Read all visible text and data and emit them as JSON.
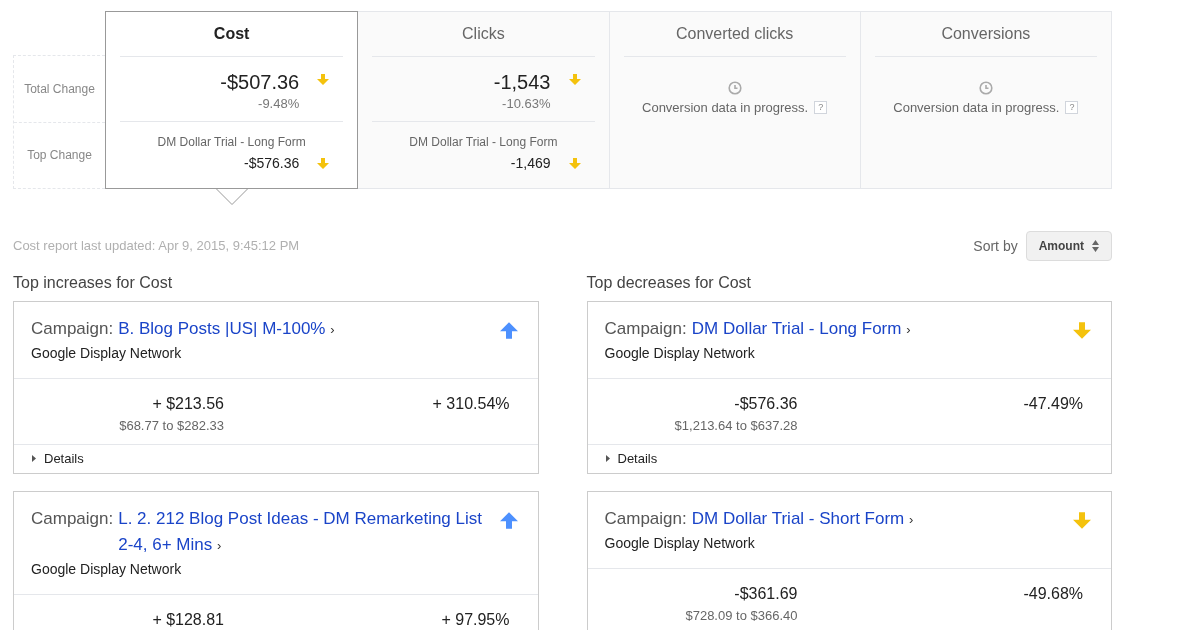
{
  "row_labels": [
    "Total Change",
    "Top Change"
  ],
  "metric_tabs": [
    {
      "title": "Cost",
      "selected": true,
      "kind": "data",
      "total": "-$507.36",
      "percent": "-9.48%",
      "increase": false,
      "top_name": "DM Dollar Trial - Long Form",
      "top_value": "-$576.36",
      "top_increase": false
    },
    {
      "title": "Clicks",
      "selected": false,
      "kind": "data",
      "total": "-1,543",
      "percent": "-10.63%",
      "increase": false,
      "top_name": "DM Dollar Trial - Long Form",
      "top_value": "-1,469",
      "top_increase": false
    },
    {
      "title": "Converted clicks",
      "selected": false,
      "kind": "pending",
      "message": "Conversion data in progress.",
      "help": "?"
    },
    {
      "title": "Conversions",
      "selected": false,
      "kind": "pending",
      "message": "Conversion data in progress.",
      "help": "?"
    }
  ],
  "updated": "Cost report last updated: Apr 9, 2015, 9:45:12 PM",
  "sort": {
    "label": "Sort by",
    "value": "Amount"
  },
  "columns": [
    {
      "heading": "Top increases for Cost",
      "cards": [
        {
          "prefix": "Campaign:",
          "name": "B. Blog Posts |US| M-100%",
          "chevron": "›",
          "network": "Google Display Network",
          "increase": true,
          "change": "+ $213.56",
          "range": "$68.77 to $282.33",
          "percent": "+ 310.54%",
          "details": "Details"
        },
        {
          "prefix": "Campaign:",
          "name": "L. 2. 212 Blog Post Ideas - DM Remarketing List 2-4, 6+ Mins",
          "chevron": "›",
          "network": "Google Display Network",
          "increase": true,
          "change": "+ $128.81",
          "percent": "+ 97.95%"
        }
      ]
    },
    {
      "heading": "Top decreases for Cost",
      "cards": [
        {
          "prefix": "Campaign:",
          "name": "DM Dollar Trial - Long Form",
          "chevron": "›",
          "network": "Google Display Network",
          "increase": false,
          "change": "-$576.36",
          "range": "$1,213.64 to $637.28",
          "percent": "-47.49%",
          "details": "Details"
        },
        {
          "prefix": "Campaign:",
          "name": "DM Dollar Trial - Short Form",
          "chevron": "›",
          "network": "Google Display Network",
          "increase": false,
          "change": "-$361.69",
          "range": "$728.09 to $366.40",
          "percent": "-49.68%"
        }
      ]
    }
  ]
}
